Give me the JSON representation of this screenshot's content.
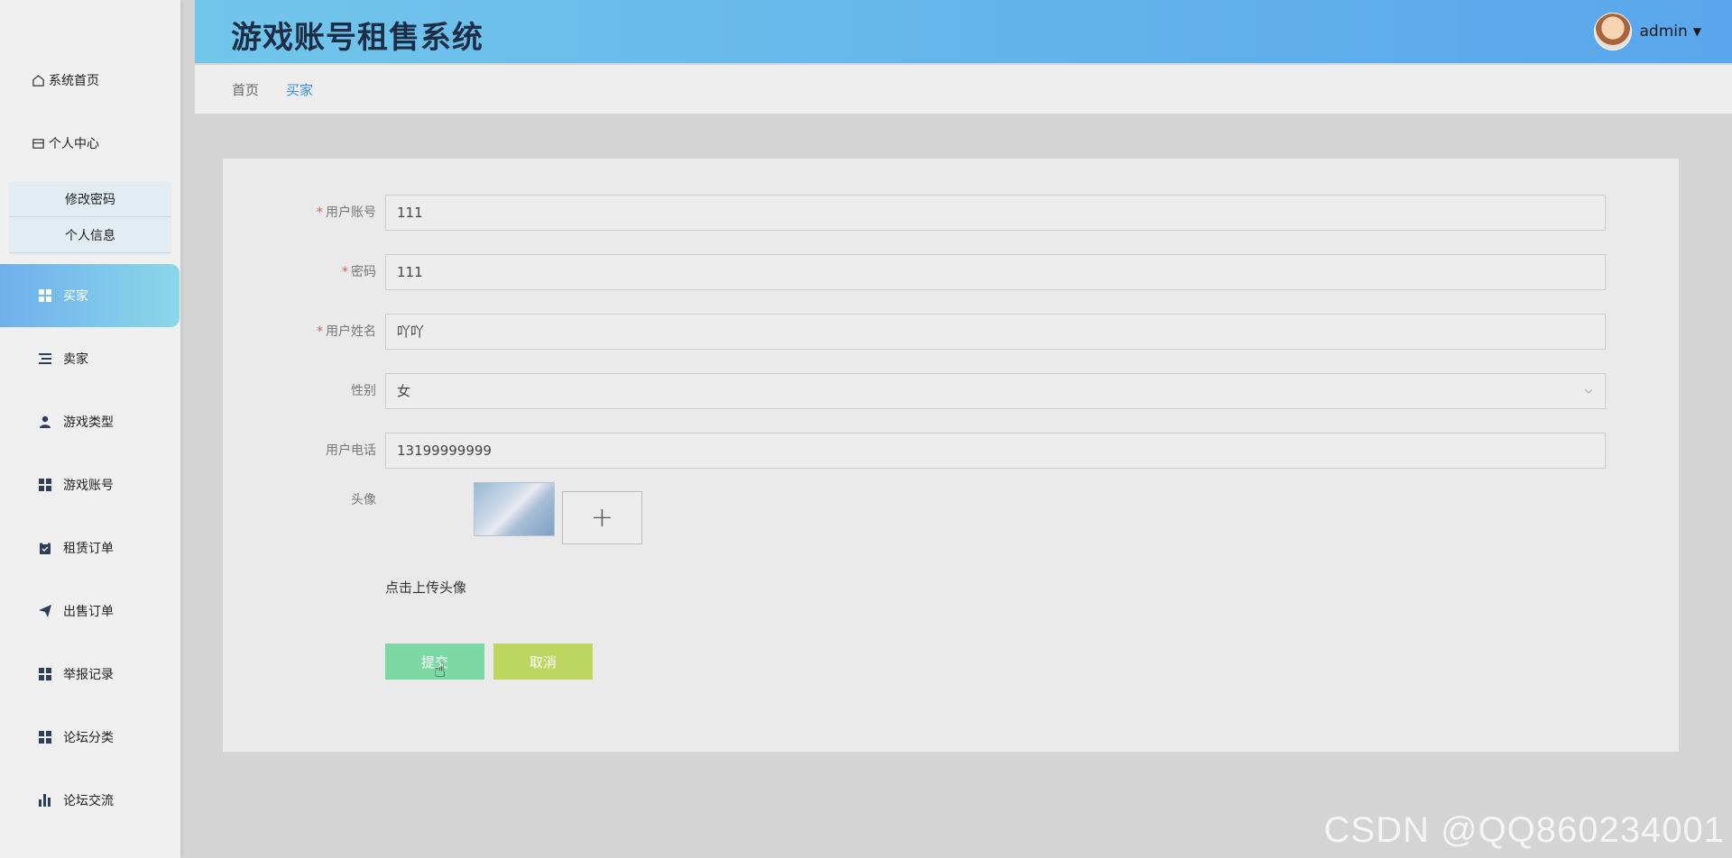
{
  "app": {
    "title": "游戏账号租售系统"
  },
  "user": {
    "name": "admin"
  },
  "sidebar": {
    "top_items": [
      {
        "label": "系统首页",
        "icon": "home-icon"
      },
      {
        "label": "个人中心",
        "icon": "card-icon"
      }
    ],
    "submenu": [
      {
        "label": "修改密码"
      },
      {
        "label": "个人信息"
      }
    ],
    "menu_items": [
      {
        "label": "买家",
        "icon": "grid-icon",
        "active": true
      },
      {
        "label": "卖家",
        "icon": "list-icon"
      },
      {
        "label": "游戏类型",
        "icon": "user-icon"
      },
      {
        "label": "游戏账号",
        "icon": "grid-icon"
      },
      {
        "label": "租赁订单",
        "icon": "clipboard-icon"
      },
      {
        "label": "出售订单",
        "icon": "send-icon"
      },
      {
        "label": "举报记录",
        "icon": "grid-icon"
      },
      {
        "label": "论坛分类",
        "icon": "grid-icon"
      },
      {
        "label": "论坛交流",
        "icon": "bar-chart-icon"
      }
    ]
  },
  "breadcrumb": {
    "home": "首页",
    "current": "买家"
  },
  "form": {
    "fields": [
      {
        "label": "用户账号",
        "required": true,
        "value": "111"
      },
      {
        "label": "密码",
        "required": true,
        "value": "111"
      },
      {
        "label": "用户姓名",
        "required": true,
        "value": "吖吖"
      },
      {
        "label": "性别",
        "required": false,
        "value": "女",
        "type": "select"
      },
      {
        "label": "用户电话",
        "required": false,
        "value": "13199999999"
      }
    ],
    "avatar_label": "头像",
    "upload_hint": "点击上传头像",
    "submit_label": "提交",
    "cancel_label": "取消"
  },
  "watermark": "CSDN @QQ860234001",
  "colors": {
    "accent": "#3a8ee6",
    "header_start": "#72c6ea",
    "header_end": "#5aa6ec",
    "submit": "#7dd9a3",
    "cancel": "#bcd660",
    "required": "#e05a5a"
  }
}
